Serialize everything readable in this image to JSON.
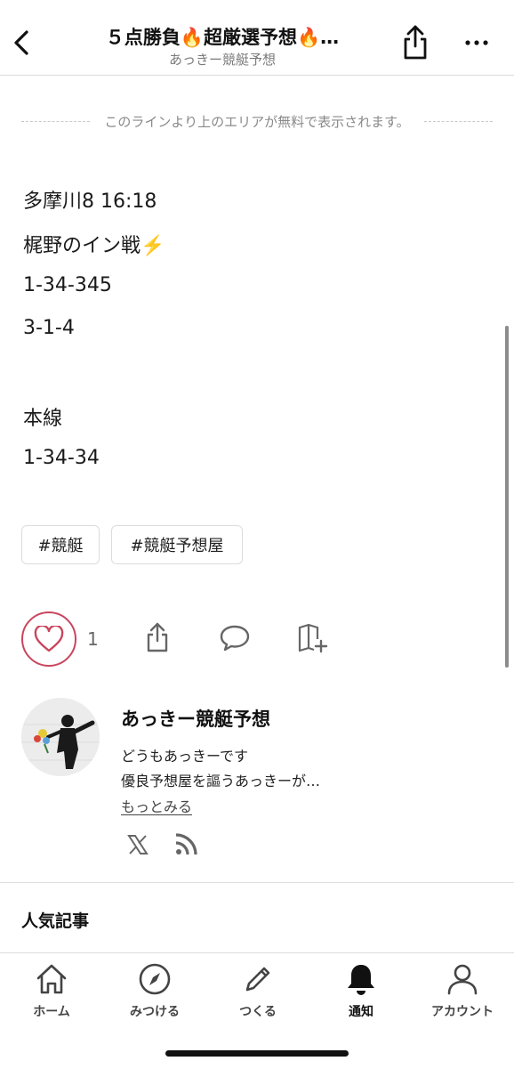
{
  "header": {
    "title": "５点勝負🔥超厳選予想🔥…",
    "author": "あっきー競艇予想"
  },
  "free_line": "このラインより上のエリアが無料で表示されます。",
  "content": {
    "lines": [
      "多摩川8 16:18",
      "梶野のイン戦⚡️",
      "1-34-345",
      "3-1-4",
      "本線",
      "1-34-34"
    ]
  },
  "tags": [
    "#競艇",
    "#競艇予想屋"
  ],
  "actions": {
    "like_count": "1"
  },
  "profile": {
    "name": "あっきー競艇予想",
    "bio_line1": "どうもあっきーです",
    "bio_line2": "優良予想屋を謳うあっきーが…",
    "more_label": "もっとみる"
  },
  "section_title": "人気記事",
  "tabs": [
    {
      "label": "ホーム",
      "icon": "home-icon"
    },
    {
      "label": "みつける",
      "icon": "compass-icon"
    },
    {
      "label": "つくる",
      "icon": "pencil-icon"
    },
    {
      "label": "通知",
      "icon": "bell-icon"
    },
    {
      "label": "アカウント",
      "icon": "person-icon"
    }
  ],
  "colors": {
    "like_accent": "#c9465e",
    "text": "#111111",
    "muted": "#8a8a8a"
  }
}
